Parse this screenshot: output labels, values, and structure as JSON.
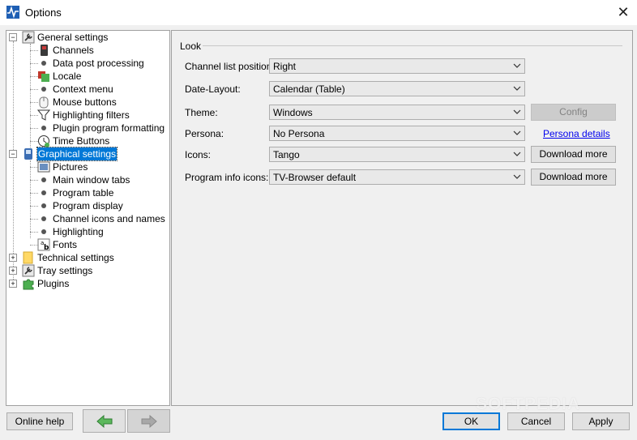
{
  "window": {
    "title": "Options",
    "close_glyph": "✕"
  },
  "tree": {
    "general_settings": "General settings",
    "channels": "Channels",
    "data_post_processing": "Data post processing",
    "locale": "Locale",
    "context_menu": "Context menu",
    "mouse_buttons": "Mouse buttons",
    "highlighting_filters": "Highlighting filters",
    "plugin_program_formatting": "Plugin program formatting",
    "time_buttons": "Time Buttons",
    "graphical_settings": "Graphical settings",
    "pictures": "Pictures",
    "main_window_tabs": "Main window tabs",
    "program_table": "Program table",
    "program_display": "Program display",
    "channel_icons_and_names": "Channel icons and names",
    "highlighting": "Highlighting",
    "fonts": "Fonts",
    "technical_settings": "Technical settings",
    "tray_settings": "Tray settings",
    "plugins": "Plugins",
    "expander_minus": "−",
    "expander_plus": "+"
  },
  "look": {
    "group_title": "Look",
    "channel_list_position": {
      "label": "Channel list position:",
      "value": "Right"
    },
    "date_layout": {
      "label": "Date-Layout:",
      "value": "Calendar (Table)"
    },
    "theme": {
      "label": "Theme:",
      "value": "Windows",
      "button": "Config"
    },
    "persona": {
      "label": "Persona:",
      "value": "No Persona",
      "link": "Persona details"
    },
    "icons": {
      "label": "Icons:",
      "value": "Tango",
      "button": "Download more"
    },
    "program_info_icons": {
      "label": "Program info icons:",
      "value": "TV-Browser default",
      "button": "Download more"
    }
  },
  "footer": {
    "online_help": "Online help",
    "ok": "OK",
    "cancel": "Cancel",
    "apply": "Apply"
  },
  "watermark": "SOFTPEDIA",
  "colors": {
    "selection": "#0078d7",
    "link": "#0000ee",
    "accent_green": "#4caf50"
  }
}
